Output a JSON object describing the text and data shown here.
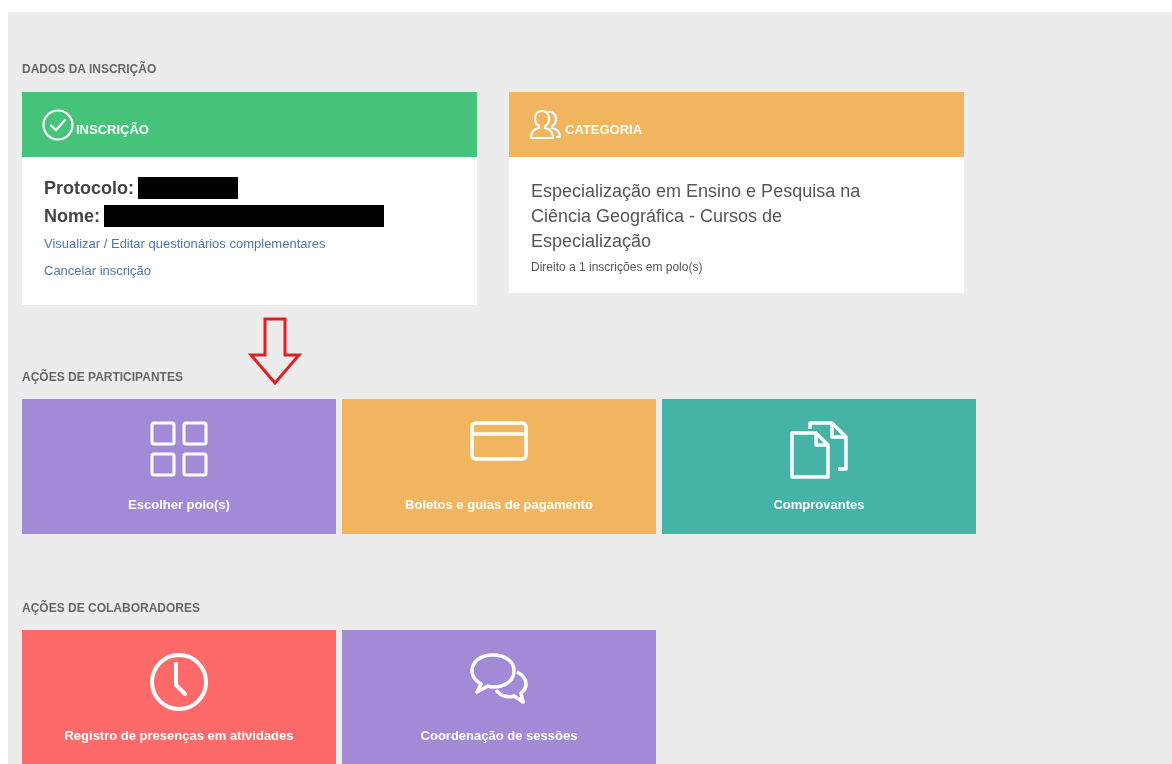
{
  "registration": {
    "heading": "DADOS DA INSCRIÇÃO",
    "inscription_card": {
      "title": "INSCRIÇÃO",
      "color": "#47c47b",
      "fields": [
        {
          "label": "Protocolo:",
          "redacted": true
        },
        {
          "label": "Nome:",
          "redacted": true
        }
      ],
      "links": [
        "Visualizar / Editar questionários complementares",
        "Cancelar inscrição"
      ]
    },
    "category_card": {
      "title": "CATEGORIA",
      "color": "#f0b55e",
      "name": "Especialização em Ensino e Pesquisa na Ciência Geográfica - Cursos de Especialização",
      "note": "Direito a 1 inscrições em polo(s)"
    }
  },
  "participant_actions": {
    "heading": "AÇÕES DE PARTICIPANTES",
    "tiles": [
      {
        "label": "Escolher polo(s)",
        "kind": "grid",
        "color": "#a28ad6"
      },
      {
        "label": "Boletos e guias de pagamento",
        "kind": "card",
        "color": "#f0b55e"
      },
      {
        "label": "Comprovantes",
        "kind": "documents",
        "color": "#45b3a5"
      }
    ]
  },
  "collaborator_actions": {
    "heading": "AÇÕES DE COLABORADORES",
    "tiles": [
      {
        "label": "Registro de presenças em atividades",
        "kind": "clock",
        "color": "#fe6a6a"
      },
      {
        "label": "Coordenação de sessões",
        "kind": "chat",
        "color": "#a28ad6"
      }
    ]
  }
}
